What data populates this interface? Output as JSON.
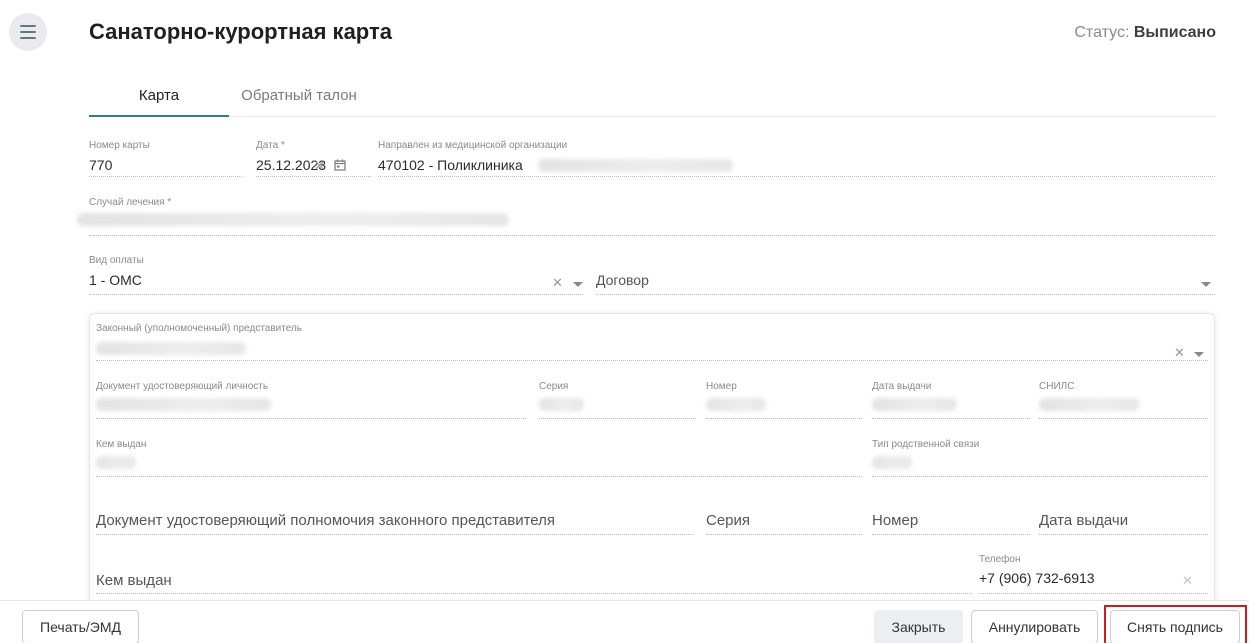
{
  "header": {
    "title": "Санаторно-курортная карта",
    "status_label": "Статус:",
    "status_value": "Выписано"
  },
  "tabs": [
    {
      "label": "Карта",
      "active": true
    },
    {
      "label": "Обратный талон",
      "active": false
    }
  ],
  "form": {
    "card_number": {
      "label": "Номер карты",
      "value": "770"
    },
    "date": {
      "label": "Дата *",
      "value": "25.12.2023"
    },
    "referred_from": {
      "label": "Направлен из медицинской организации",
      "value": "470102 - Поликлиника"
    },
    "treatment_case": {
      "label": "Случай лечения *"
    },
    "payment_type": {
      "label": "Вид оплаты",
      "value": "1 - ОМС"
    },
    "contract": {
      "placeholder": "Договор"
    }
  },
  "representative": {
    "legal_rep": {
      "label": "Законный (уполномоченный) представитель"
    },
    "id_document": {
      "label": "Документ удостоверяющий личность"
    },
    "series": {
      "label": "Серия"
    },
    "number": {
      "label": "Номер"
    },
    "issue_date": {
      "label": "Дата выдачи"
    },
    "snils": {
      "label": "СНИЛС"
    },
    "issued_by": {
      "label": "Кем выдан"
    },
    "relation_type": {
      "label": "Тип родственной связи"
    },
    "authority_doc": {
      "placeholder": "Документ удостоверяющий полномочия законного представителя"
    },
    "authority_series": {
      "placeholder": "Серия"
    },
    "authority_number": {
      "placeholder": "Номер"
    },
    "authority_issue_date": {
      "placeholder": "Дата выдачи"
    },
    "authority_issued_by": {
      "placeholder": "Кем выдан"
    },
    "phone": {
      "label": "Телефон",
      "value": "+7 (906) 732-6913"
    }
  },
  "footer": {
    "print_label": "Печать/ЭМД",
    "close_label": "Закрыть",
    "annul_label": "Аннулировать",
    "unsign_label": "Снять подпись"
  },
  "icons": {
    "menu": "hamburger-icon",
    "clear": "close-icon",
    "calendar": "calendar-icon",
    "dropdown": "chevron-down-icon"
  },
  "colors": {
    "tab_active_underline": "#2f7d8f",
    "highlight_border": "#d11a1a"
  }
}
